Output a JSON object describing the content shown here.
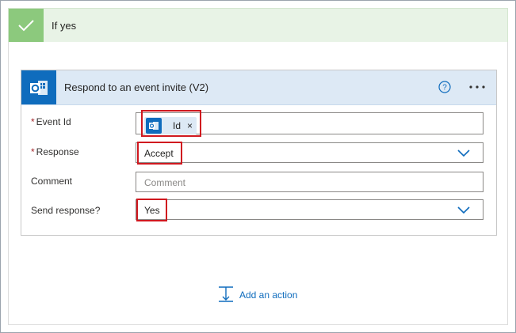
{
  "condition": {
    "title": "If yes"
  },
  "action": {
    "title": "Respond to an event invite (V2)",
    "fields": {
      "event_id": {
        "label": "Event Id",
        "required": true,
        "token": "Id"
      },
      "response": {
        "label": "Response",
        "required": true,
        "value": "Accept"
      },
      "comment": {
        "label": "Comment",
        "required": false,
        "placeholder": "Comment"
      },
      "send_response": {
        "label": "Send response?",
        "required": false,
        "value": "Yes"
      }
    }
  },
  "footer": {
    "add_action_label": "Add an action"
  },
  "icons": {
    "check": "check-icon",
    "outlook": "outlook-icon",
    "help": "help-icon",
    "more": "more-icon",
    "chevron": "chevron-down-icon",
    "add_action": "add-action-icon",
    "remove": "remove-token-icon"
  },
  "colors": {
    "success_header_bg": "#e8f3e6",
    "success_check_bg": "#8cc97d",
    "card_header_bg": "#dde9f5",
    "outlook_blue": "#0f6cbd",
    "highlight_red": "#d0181f",
    "required_red": "#a4262c",
    "link_blue": "#0f6cbd"
  }
}
